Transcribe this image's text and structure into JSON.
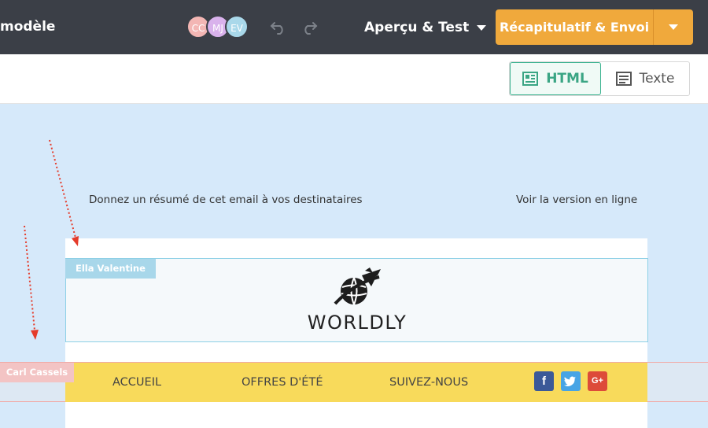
{
  "topbar": {
    "title": "modèle",
    "collaborators": [
      "CC",
      "MJ",
      "EV"
    ],
    "preview_label": "Aperçu & Test",
    "send_label": "Récapitulatif & Envoi"
  },
  "view_toggle": {
    "html_label": "HTML",
    "text_label": "Texte",
    "selected": "HTML"
  },
  "email": {
    "preheader_text": "Donnez un résumé de cet email à vos destinataires",
    "online_link": "Voir la version en ligne",
    "logo_text": "WORLDLY",
    "nav_items": [
      "ACCUEIL",
      "OFFRES D'ÉTÉ",
      "SUIVEZ-NOUS"
    ],
    "social": {
      "facebook": "f",
      "google_plus": "G+"
    }
  },
  "editors": {
    "logo_block_editor": "Ella Valentine",
    "nav_block_editor": "Carl Cassels"
  },
  "colors": {
    "topbar": "#3b3f47",
    "send_button": "#f0a93c",
    "html_toggle_accent": "#3aa584",
    "canvas_background": "#d6e9fa",
    "nav_background": "#f8da5b",
    "arrow": "#e53b2a"
  }
}
